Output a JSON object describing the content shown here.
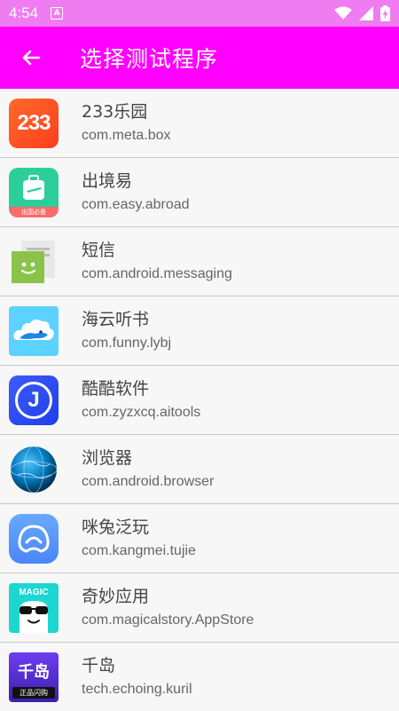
{
  "status_bar": {
    "time": "4:54",
    "notif_letter": "A"
  },
  "header": {
    "title": "选择测试程序"
  },
  "icon_text": {
    "meta_box": "233",
    "easy_abroad": "出国必备",
    "aitools": "J",
    "magic": "MAGIC",
    "kuril_top": "千岛",
    "kuril_bottom": "正品闪购"
  },
  "apps": [
    {
      "name": "233乐园",
      "package": "com.meta.box",
      "icon": "meta-box-icon"
    },
    {
      "name": "出境易",
      "package": "com.easy.abroad",
      "icon": "suitcase-icon"
    },
    {
      "name": "短信",
      "package": "com.android.messaging",
      "icon": "messaging-icon"
    },
    {
      "name": "海云听书",
      "package": "com.funny.lybj",
      "icon": "cloud-icon"
    },
    {
      "name": "酷酷软件",
      "package": "com.zyzxcq.aitools",
      "icon": "letter-j-icon"
    },
    {
      "name": "浏览器",
      "package": "com.android.browser",
      "icon": "globe-icon"
    },
    {
      "name": "咪兔泛玩",
      "package": "com.kangmei.tujie",
      "icon": "rabbit-icon"
    },
    {
      "name": "奇妙应用",
      "package": "com.magicalstory.AppStore",
      "icon": "magic-sunglasses-icon"
    },
    {
      "name": "千岛",
      "package": "tech.echoing.kuril",
      "icon": "kuril-icon"
    }
  ]
}
